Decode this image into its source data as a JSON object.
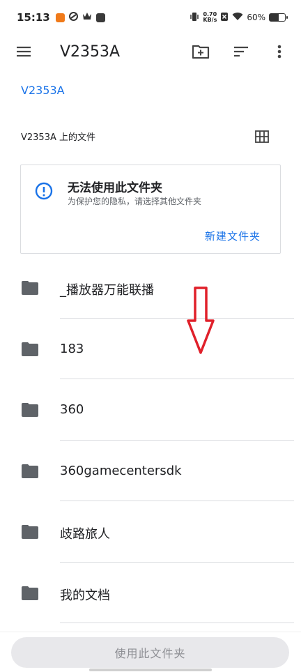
{
  "status_bar": {
    "time": "15:13",
    "net_speed_value": "0.70",
    "net_speed_unit": "KB/s",
    "battery_percent": "60%",
    "battery_level": 0.6
  },
  "app_bar": {
    "title": "V2353A"
  },
  "breadcrumb": "V2353A",
  "section_label": "V2353A 上的文件",
  "notice": {
    "title": "无法使用此文件夹",
    "subtitle": "为保护您的隐私，请选择其他文件夹",
    "action": "新建文件夹"
  },
  "files": [
    {
      "name": "_播放器万能联播"
    },
    {
      "name": "183"
    },
    {
      "name": "360"
    },
    {
      "name": "360gamecentersdk"
    },
    {
      "name": "歧路旅人"
    },
    {
      "name": "我的文档"
    }
  ],
  "bottom": {
    "use_folder_label": "使用此文件夹"
  },
  "colors": {
    "accent": "#1a73e8",
    "annotation_arrow": "#e0202a"
  }
}
